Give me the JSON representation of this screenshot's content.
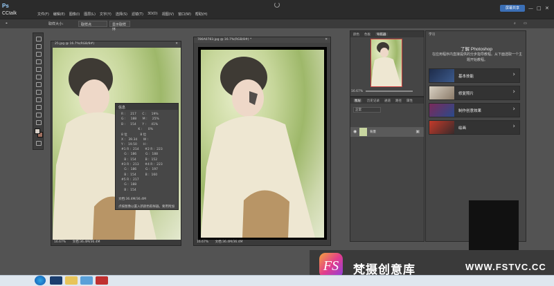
{
  "app": {
    "logo": "Ps",
    "cc_label": "CCtalk",
    "menu": [
      "文件(F)",
      "编辑(E)",
      "图像(I)",
      "图层(L)",
      "文字(Y)",
      "选择(S)",
      "滤镜(T)",
      "3D(D)",
      "视图(V)",
      "窗口(W)",
      "帮助(H)"
    ],
    "share_label": "屏幕共享",
    "window_controls": [
      "—",
      "□",
      "✕"
    ]
  },
  "options": {
    "sample_label": "取样大小:",
    "sample_value": "取样点",
    "show_ring": "显示取样环"
  },
  "doc_left": {
    "title": "25.jpg @ 16.7%(RGB/8#)",
    "zoom": "16.67%",
    "doc_info": "文档:36.4M/36.4M"
  },
  "doc_right": {
    "title": "786A0783.jpg @ 16.7%(RGB/8#) *",
    "zoom": "16.67%",
    "doc_info": "文档:36.4M/36.4M"
  },
  "info_panel": {
    "title": "信息",
    "rows": [
      "R :     217      C :     19%",
      "G :     188      M :     25%",
      "B :     154      Y :     41%",
      "                 K :      0%",
      "8 位             8 位",
      "X :   39.34      W :",
      "Y :   19.50      H :",
      "#1 R :  214      #2 R :  223",
      "   G :  186         G :  188",
      "   B :  154         B :  152",
      "#3 R :  213      #4 R :  223",
      "   G :  186         G :  197",
      "   B :  154         B :  160",
      "#5 R :  217",
      "   G :  188",
      "   B :  154"
    ],
    "doc": "文档:36.4M/36.4M",
    "hint": "点按图像以置入新颜色取样器。要用附加"
  },
  "navigator": {
    "tabs": [
      "颜色",
      "色板",
      "导航器"
    ],
    "zoom": "16.67%"
  },
  "layers": {
    "tabs": [
      "图层",
      "历史记录",
      "通道",
      "路径",
      "属性"
    ],
    "kind_label": "正常",
    "layer_name": "背景"
  },
  "learn": {
    "tab": "学习",
    "title": "了解 Photoshop",
    "desc": "在应用程序内直接提供的分步指导教程。从下面选取一个主题开始教程。",
    "items": [
      "基本技能",
      "修复照片",
      "制作创意效果",
      "绘画"
    ],
    "arrow": "›"
  },
  "watermark": {
    "logo_text": "FS",
    "brand": "梵摄创意库",
    "domain": "WWW.FSTVC.CC"
  }
}
